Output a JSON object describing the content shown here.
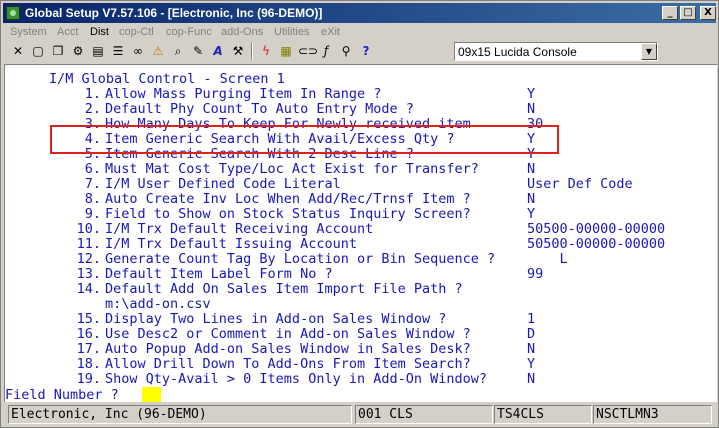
{
  "window": {
    "title": "Global Setup V7.57.106 - [Electronic, Inc (96-DEMO)]",
    "min_label": "_",
    "max_label": "□",
    "close_label": "X"
  },
  "menu": {
    "items": [
      "System",
      "Acct",
      "Dist",
      "cop-Ctl",
      "cop-Func",
      "add-Ons",
      "Utilities",
      "eXit"
    ],
    "active": "Dist"
  },
  "toolbar": {
    "icons": [
      "close-icon",
      "new-icon",
      "copy-icon",
      "settings-icon",
      "print-icon",
      "notes-icon",
      "binoculars-icon",
      "warning-icon",
      "search-icon",
      "script-icon",
      "font-icon",
      "tools-icon",
      "lightning-icon",
      "calculator-icon",
      "link-icon",
      "function-icon",
      "zoom-icon",
      "help-icon"
    ],
    "font_select_value": "09x15 Lucida Console"
  },
  "terminal": {
    "screen_title": "I/M Global Control - Screen 1",
    "rows": [
      {
        "num": "1.",
        "label": "Allow Mass Purging Item In Range ?",
        "value": "Y"
      },
      {
        "num": "2.",
        "label": "Default Phy Count To Auto Entry Mode ?",
        "value": "N"
      },
      {
        "num": "3.",
        "label": "How Many Days To Keep For Newly received item",
        "value": "30"
      },
      {
        "num": "4.",
        "label": "Item Generic Search With Avail/Excess Qty ?",
        "value": "Y"
      },
      {
        "num": "5.",
        "label": "Item Generic Search With 2 Desc Line ?",
        "value": "Y"
      },
      {
        "num": "6.",
        "label": "Must Mat Cost Type/Loc Act Exist for Transfer?",
        "value": "N"
      },
      {
        "num": "7.",
        "label": "I/M User Defined Code Literal",
        "value": "User Def Code"
      },
      {
        "num": "8.",
        "label": "Auto Create Inv Loc When Add/Rec/Trnsf Item ?",
        "value": "N"
      },
      {
        "num": "9.",
        "label": "Field to Show on Stock Status Inquiry Screen?",
        "value": "Y"
      },
      {
        "num": "10.",
        "label": "I/M Trx Default Receiving Account",
        "value": "50500-00000-00000"
      },
      {
        "num": "11.",
        "label": "I/M Trx Default Issuing Account",
        "value": "50500-00000-00000"
      },
      {
        "num": "12.",
        "label": "Generate Count Tag By Location or Bin Sequence ?",
        "value": "    L"
      },
      {
        "num": "13.",
        "label": "Default Item Label Form No ?",
        "value": "99"
      },
      {
        "num": "14.",
        "label": "Default Add On Sales Item Import File Path ?",
        "value": ""
      },
      {
        "num": "",
        "label": "m:\\add-on.csv",
        "value": ""
      },
      {
        "num": "15.",
        "label": "Display Two Lines in Add-on Sales Window ?",
        "value": "1"
      },
      {
        "num": "16.",
        "label": "Use Desc2 or Comment in Add-on Sales Window ?",
        "value": "D"
      },
      {
        "num": "17.",
        "label": "Auto Popup Add-on Sales Window in Sales Desk?",
        "value": "N"
      },
      {
        "num": "18.",
        "label": "Allow Drill Down To Add-Ons From Item Search?",
        "value": "Y"
      },
      {
        "num": "19.",
        "label": "Show Qty-Avail > 0 Items Only in Add-On Window?",
        "value": "N"
      }
    ],
    "field_prompt": "Field Number ?",
    "field_value": ""
  },
  "status": {
    "company": "Electronic, Inc (96-DEMO)",
    "cls": "001 CLS",
    "terminal": "TS4CLS",
    "node": "NSCTLMN3"
  },
  "colors": {
    "terminal_text": "#1818b8",
    "highlight_border": "#e02020",
    "input_bg": "#ffff00",
    "title_gradient_start": "#0a246a"
  }
}
